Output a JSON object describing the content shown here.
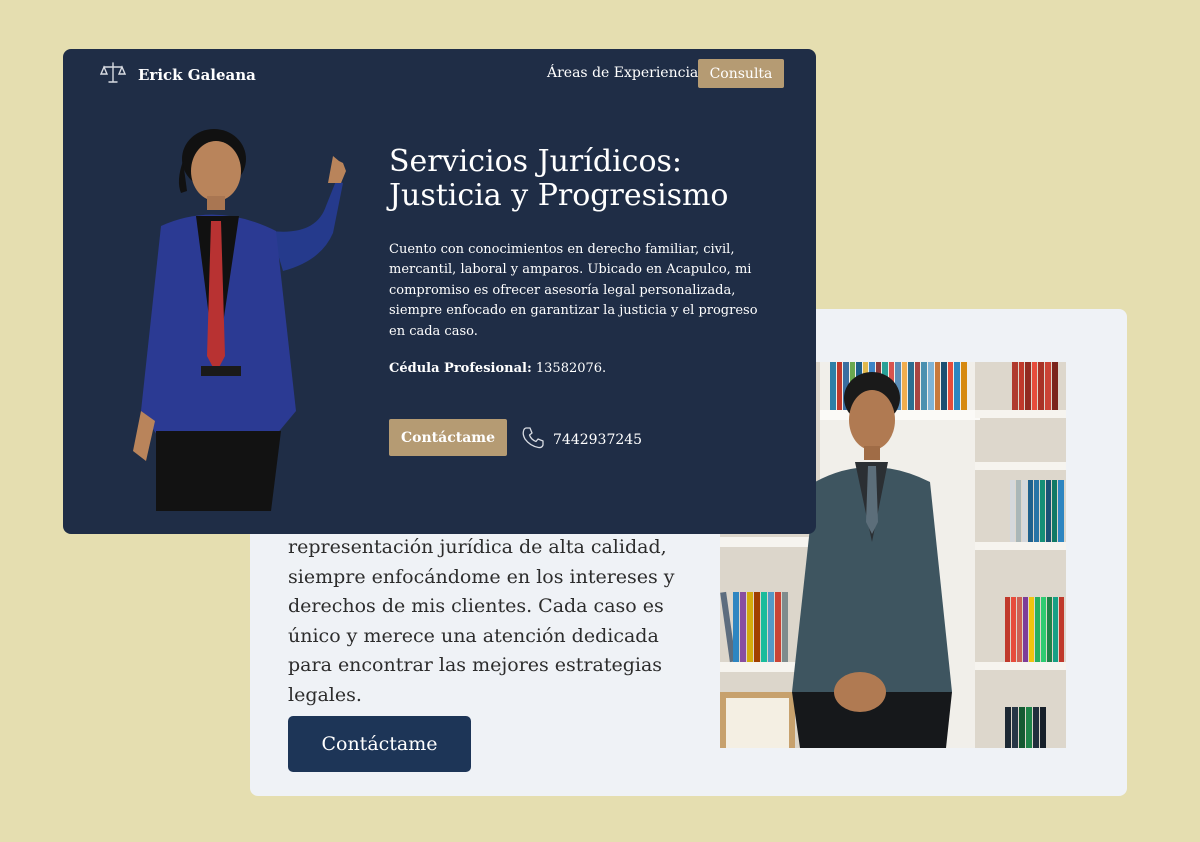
{
  "back": {
    "text": "representación jurídica de alta calidad, siempre enfocándome en los intereses y derechos de mis clientes. Cada caso es único y merece una atención dedicada para encontrar las mejores estrategias legales.",
    "cta": "Contáctame"
  },
  "nav": {
    "brand": "Erick Galeana",
    "logo_icon": "scales-of-justice-icon",
    "link": "Áreas de Experiencia",
    "cta": "Consulta"
  },
  "hero": {
    "title": "Servicios Jurídicos: Justicia y Progresismo",
    "description": "Cuento con conocimientos en derecho familiar, civil, mercantil, laboral y amparos. Ubicado en Acapulco, mi compromiso es ofrecer asesoría legal personalizada, siempre enfocado en garantizar la justicia y el progreso en cada caso.",
    "cedula_label": "Cédula Profesional:",
    "cedula_value": "13582076.",
    "cta": "Contáctame",
    "phone_icon": "phone-icon",
    "phone": "7442937245"
  },
  "colors": {
    "page_bg": "#e5deb0",
    "front_card": "#1f2d46",
    "accent": "#b59b73",
    "back_card": "#eff2f6",
    "back_button": "#1d3557"
  }
}
